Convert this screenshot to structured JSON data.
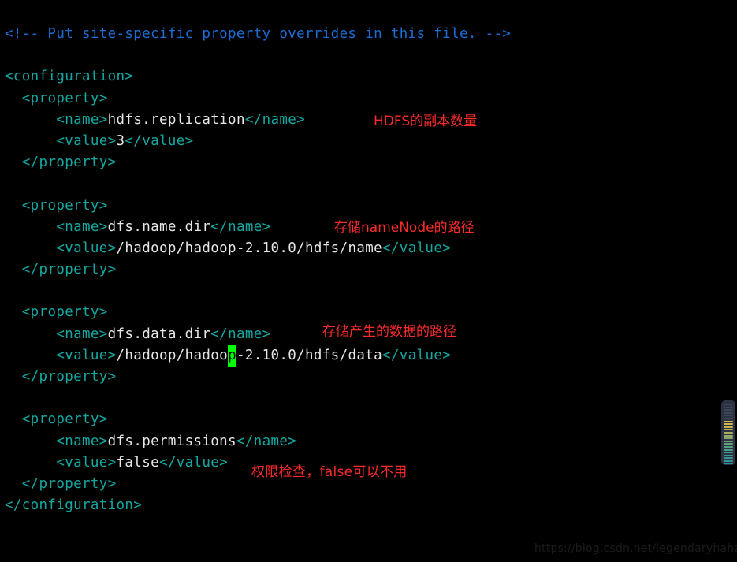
{
  "editor": {
    "background_color": "#000000",
    "cursor_color": "#00ff00",
    "colors": {
      "comment": "#1b6dd4",
      "tag": "#15a6a0",
      "text": "#e6e6e6",
      "annotation": "#fb2b2b",
      "minimap_bg": "#2b3241"
    },
    "lines": [
      {
        "tokens": [
          {
            "type": "comment",
            "text": "<!-- Put site-specific property overrides in this file. -->"
          }
        ]
      },
      {
        "tokens": []
      },
      {
        "tokens": [
          {
            "type": "tag",
            "text": "<configuration>"
          }
        ]
      },
      {
        "tokens": [
          {
            "type": "plain",
            "text": "  "
          },
          {
            "type": "tag",
            "text": "<property>"
          }
        ]
      },
      {
        "tokens": [
          {
            "type": "plain",
            "text": "      "
          },
          {
            "type": "tag",
            "text": "<name>"
          },
          {
            "type": "text",
            "text": "hdfs.replication"
          },
          {
            "type": "tag",
            "text": "</name>"
          }
        ]
      },
      {
        "tokens": [
          {
            "type": "plain",
            "text": "      "
          },
          {
            "type": "tag",
            "text": "<value>"
          },
          {
            "type": "text",
            "text": "3"
          },
          {
            "type": "tag",
            "text": "</value>"
          }
        ]
      },
      {
        "tokens": [
          {
            "type": "plain",
            "text": "  "
          },
          {
            "type": "tag",
            "text": "</property>"
          }
        ]
      },
      {
        "tokens": []
      },
      {
        "tokens": [
          {
            "type": "plain",
            "text": "  "
          },
          {
            "type": "tag",
            "text": "<property>"
          }
        ]
      },
      {
        "tokens": [
          {
            "type": "plain",
            "text": "      "
          },
          {
            "type": "tag",
            "text": "<name>"
          },
          {
            "type": "text",
            "text": "dfs.name.dir"
          },
          {
            "type": "tag",
            "text": "</name>"
          }
        ]
      },
      {
        "tokens": [
          {
            "type": "plain",
            "text": "      "
          },
          {
            "type": "tag",
            "text": "<value>"
          },
          {
            "type": "text",
            "text": "/hadoop/hadoop-2.10.0/hdfs/name"
          },
          {
            "type": "tag",
            "text": "</value>"
          }
        ]
      },
      {
        "tokens": [
          {
            "type": "plain",
            "text": "  "
          },
          {
            "type": "tag",
            "text": "</property>"
          }
        ]
      },
      {
        "tokens": []
      },
      {
        "tokens": [
          {
            "type": "plain",
            "text": "  "
          },
          {
            "type": "tag",
            "text": "<property>"
          }
        ]
      },
      {
        "tokens": [
          {
            "type": "plain",
            "text": "      "
          },
          {
            "type": "tag",
            "text": "<name>"
          },
          {
            "type": "text",
            "text": "dfs.data.dir"
          },
          {
            "type": "tag",
            "text": "</name>"
          }
        ]
      },
      {
        "tokens": [
          {
            "type": "plain",
            "text": "      "
          },
          {
            "type": "tag",
            "text": "<value>"
          },
          {
            "type": "text",
            "text": "/hadoop/hadoo"
          },
          {
            "type": "cursor",
            "text": "p"
          },
          {
            "type": "text",
            "text": "-2.10.0/hdfs/data"
          },
          {
            "type": "tag",
            "text": "</value>"
          }
        ]
      },
      {
        "tokens": [
          {
            "type": "plain",
            "text": "  "
          },
          {
            "type": "tag",
            "text": "</property>"
          }
        ]
      },
      {
        "tokens": []
      },
      {
        "tokens": [
          {
            "type": "plain",
            "text": "  "
          },
          {
            "type": "tag",
            "text": "<property>"
          }
        ]
      },
      {
        "tokens": [
          {
            "type": "plain",
            "text": "      "
          },
          {
            "type": "tag",
            "text": "<name>"
          },
          {
            "type": "text",
            "text": "dfs.permissions"
          },
          {
            "type": "tag",
            "text": "</name>"
          }
        ]
      },
      {
        "tokens": [
          {
            "type": "plain",
            "text": "      "
          },
          {
            "type": "tag",
            "text": "<value>"
          },
          {
            "type": "text",
            "text": "false"
          },
          {
            "type": "tag",
            "text": "</value>"
          }
        ]
      },
      {
        "tokens": [
          {
            "type": "plain",
            "text": "  "
          },
          {
            "type": "tag",
            "text": "</property>"
          }
        ]
      },
      {
        "tokens": [
          {
            "type": "tag",
            "text": "</configuration>"
          }
        ]
      }
    ]
  },
  "annotations": {
    "replication": "HDFS的副本数量",
    "name_dir": "存储nameNode的路径",
    "data_dir": "存储产生的数据的路径",
    "permissions": "权限检查，false可以不用"
  },
  "minimap": {
    "rows": [
      "#3d4454",
      "#3d4454",
      "#3d4454",
      "#3d4454",
      "#3d4454",
      "#3d4454",
      "#d2b24a",
      "#d2b24a",
      "#c9b04e",
      "#b9ae56",
      "#a8ab5e",
      "#96a866",
      "#85a56e",
      "#74a276",
      "#63a07e",
      "#559d84",
      "#4a9c88",
      "#41998c",
      "#3a9890",
      "#349694",
      "#2f9597",
      "#2b9399"
    ]
  },
  "watermark": {
    "text": "https://blog.csdn.net/legendaryhaha"
  }
}
